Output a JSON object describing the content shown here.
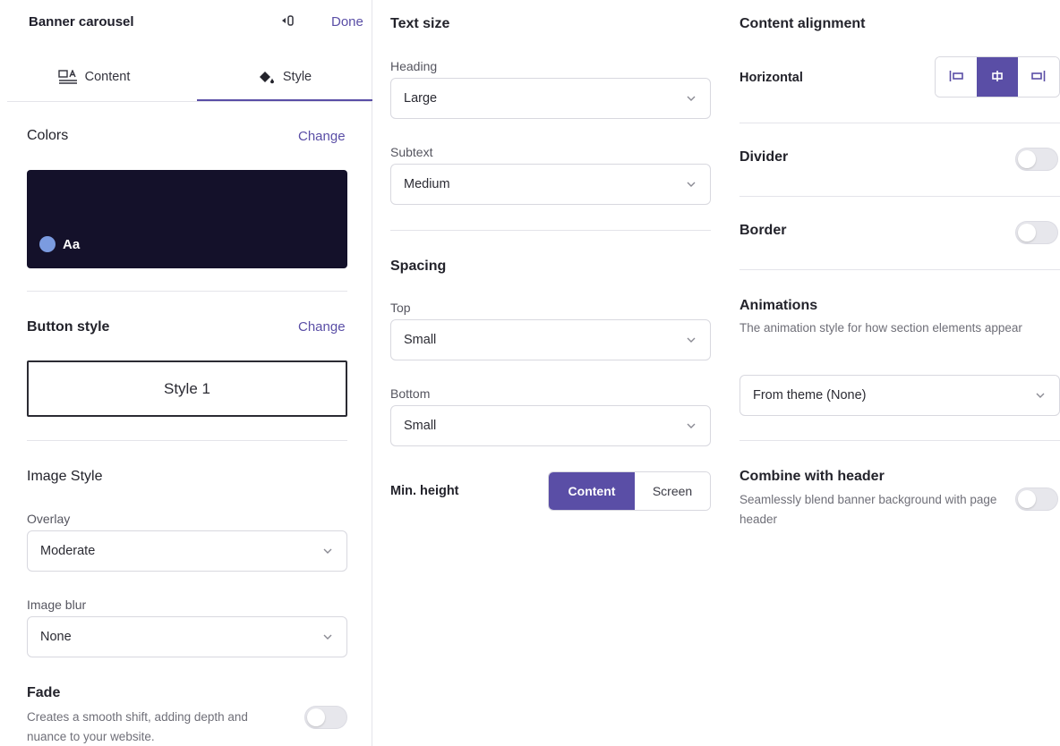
{
  "header": {
    "title": "Banner carousel",
    "done_label": "Done",
    "icon": "back-panel-icon"
  },
  "tabs": [
    {
      "label": "Content",
      "icon": "content-layout-icon",
      "active": false
    },
    {
      "label": "Style",
      "icon": "paint-bucket-icon",
      "active": true
    }
  ],
  "colors": {
    "title": "Colors",
    "change_label": "Change",
    "preview_text": "Aa",
    "preview_bg": "#14112a",
    "dot_color": "#7b9be0"
  },
  "button_style": {
    "title": "Button style",
    "change_label": "Change",
    "value": "Style 1"
  },
  "image_style": {
    "title": "Image Style",
    "overlay_label": "Overlay",
    "overlay_value": "Moderate",
    "blur_label": "Image blur",
    "blur_value": "None"
  },
  "fade": {
    "title": "Fade",
    "description": "Creates a smooth shift, adding depth and nuance to your website.",
    "enabled": false
  },
  "text_size": {
    "title": "Text size",
    "heading_label": "Heading",
    "heading_value": "Large",
    "subtext_label": "Subtext",
    "subtext_value": "Medium"
  },
  "spacing": {
    "title": "Spacing",
    "top_label": "Top",
    "top_value": "Small",
    "bottom_label": "Bottom",
    "bottom_value": "Small"
  },
  "min_height": {
    "label": "Min. height",
    "options": [
      "Content",
      "Screen"
    ],
    "selected": "Content"
  },
  "content_alignment": {
    "title": "Content alignment",
    "horizontal_label": "Horizontal",
    "selected": "center"
  },
  "divider": {
    "label": "Divider",
    "enabled": false
  },
  "border": {
    "label": "Border",
    "enabled": false
  },
  "animations": {
    "title": "Animations",
    "description": "The animation style for how section elements appear",
    "value": "From theme (None)"
  },
  "combine_header": {
    "title": "Combine with header",
    "description": "Seamlessly blend banner background with page header",
    "enabled": false
  },
  "accent_color": "#5a4ea6"
}
